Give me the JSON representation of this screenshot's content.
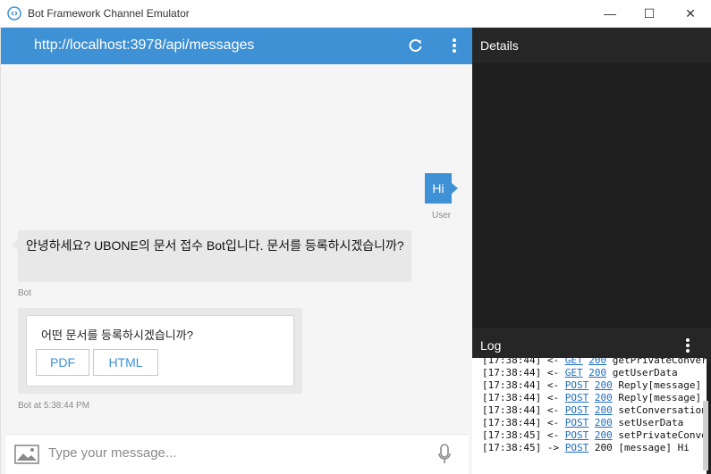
{
  "window": {
    "title": "Bot Framework Channel Emulator",
    "minimize_glyph": "—",
    "maximize_glyph": "☐",
    "close_glyph": "✕"
  },
  "address": {
    "url": "http://localhost:3978/api/messages",
    "refresh_icon": "refresh-icon",
    "more_icon": "more-vertical-icon"
  },
  "chat": {
    "user_message": "Hi",
    "user_meta": "User",
    "bot_message": "안녕하세요? UBONE의 문서 접수 Bot입니다. 문서를 등록하시겠습니까?",
    "bot_meta": "Bot",
    "card_text": "어떤 문서를 등록하시겠습니까?",
    "card_buttons": [
      "PDF",
      "HTML"
    ],
    "card_meta": "Bot at 5:38:44 PM"
  },
  "input": {
    "placeholder": "Type your message...",
    "image_icon": "image-icon",
    "mic_icon": "mic-icon"
  },
  "details": {
    "label": "Details"
  },
  "log": {
    "label": "Log",
    "lines": [
      {
        "time": "[17:38:44]",
        "dir": "<-",
        "method": "GET",
        "status": "200",
        "text": "getPrivateConver"
      },
      {
        "time": "[17:38:44]",
        "dir": "<-",
        "method": "GET",
        "status": "200",
        "text": "getUserData"
      },
      {
        "time": "[17:38:44]",
        "dir": "<-",
        "method": "POST",
        "status": "200",
        "text": "Reply[message]"
      },
      {
        "time": "[17:38:44]",
        "dir": "<-",
        "method": "POST",
        "status": "200",
        "text": "Reply[message]"
      },
      {
        "time": "[17:38:44]",
        "dir": "<-",
        "method": "POST",
        "status": "200",
        "text": "setConversation"
      },
      {
        "time": "[17:38:44]",
        "dir": "<-",
        "method": "POST",
        "status": "200",
        "text": "setUserData"
      },
      {
        "time": "[17:38:45]",
        "dir": "<-",
        "method": "POST",
        "status": "200",
        "text": "setPrivateConve"
      },
      {
        "time": "[17:38:45]",
        "dir": "->",
        "method": "POST",
        "status": "200",
        "text": "[message] Hi"
      }
    ]
  },
  "colors": {
    "accent": "#3e91d5",
    "dark_panel": "#1e1e1e",
    "bot_bubble": "#e8e8e8"
  }
}
